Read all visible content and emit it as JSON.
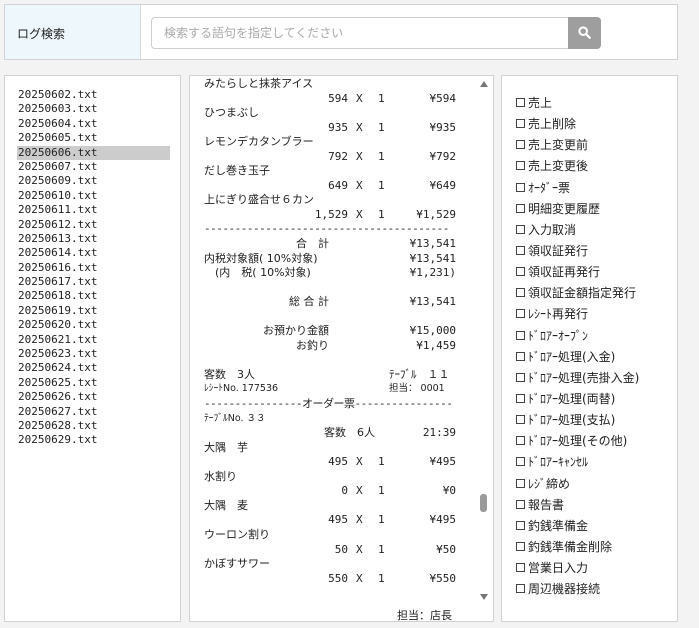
{
  "header": {
    "title": "ログ検索",
    "search_placeholder": "検索する語句を指定してください",
    "search_icon": "search-icon"
  },
  "files": [
    "20250602.txt",
    "20250603.txt",
    "20250604.txt",
    "20250605.txt",
    "20250606.txt",
    "20250607.txt",
    "20250609.txt",
    "20250610.txt",
    "20250611.txt",
    "20250612.txt",
    "20250613.txt",
    "20250614.txt",
    "20250616.txt",
    "20250617.txt",
    "20250618.txt",
    "20250619.txt",
    "20250620.txt",
    "20250621.txt",
    "20250623.txt",
    "20250624.txt",
    "20250625.txt",
    "20250626.txt",
    "20250627.txt",
    "20250628.txt",
    "20250629.txt"
  ],
  "selected_file_index": 4,
  "receipt": {
    "lines": [
      {
        "k": "name",
        "t": "みたらしと抹茶アイス"
      },
      {
        "k": "item",
        "a": "594",
        "x": "X",
        "q": "1",
        "p": "¥594"
      },
      {
        "k": "name",
        "t": "ひつまぶし"
      },
      {
        "k": "item",
        "a": "935",
        "x": "X",
        "q": "1",
        "p": "¥935"
      },
      {
        "k": "name",
        "t": "レモンデカタンブラー"
      },
      {
        "k": "item",
        "a": "792",
        "x": "X",
        "q": "1",
        "p": "¥792"
      },
      {
        "k": "name",
        "t": "だし巻き玉子"
      },
      {
        "k": "item",
        "a": "649",
        "x": "X",
        "q": "1",
        "p": "¥649"
      },
      {
        "k": "name",
        "t": "上にぎり盛合せ６カン"
      },
      {
        "k": "item",
        "a": "1,529",
        "x": "X",
        "q": "1",
        "p": "¥1,529"
      },
      {
        "k": "dash",
        "t": "----------------------------------------"
      },
      {
        "k": "total",
        "l": "合　計",
        "v": "¥13,541"
      },
      {
        "k": "lv",
        "l": "内税対象額( 10%対象)",
        "v": "¥13,541"
      },
      {
        "k": "lv",
        "l": "　(内　税( 10%対象)",
        "v": "¥1,231)"
      },
      {
        "k": "blank"
      },
      {
        "k": "total",
        "l": "総 合 計",
        "v": "¥13,541"
      },
      {
        "k": "blank"
      },
      {
        "k": "total",
        "l": "お預かり金額",
        "v": "¥15,000"
      },
      {
        "k": "total",
        "l": "お釣り",
        "v": "¥1,459"
      },
      {
        "k": "blank"
      },
      {
        "k": "info",
        "l": "客数　3人",
        "r": "ﾃｰﾌﾞﾙ　１１"
      },
      {
        "k": "info",
        "l": "ﾚｼｰﾄNo. 177536",
        "r": "担当： 0001",
        "small": true
      },
      {
        "k": "dash",
        "t": "----------------オーダー票----------------"
      },
      {
        "k": "name",
        "t": "ﾃｰﾌﾞﾙNo. ３３",
        "small": true
      },
      {
        "k": "info2",
        "l": "客数　6人",
        "r": "21:39"
      },
      {
        "k": "name",
        "t": "大隅　芋"
      },
      {
        "k": "item",
        "a": "495",
        "x": "X",
        "q": "1",
        "p": "¥495"
      },
      {
        "k": "name",
        "t": "水割り"
      },
      {
        "k": "item",
        "a": "0",
        "x": "X",
        "q": "1",
        "p": "¥0"
      },
      {
        "k": "name",
        "t": "大隅　麦"
      },
      {
        "k": "item",
        "a": "495",
        "x": "X",
        "q": "1",
        "p": "¥495"
      },
      {
        "k": "name",
        "t": "ウーロン割り"
      },
      {
        "k": "item",
        "a": "50",
        "x": "X",
        "q": "1",
        "p": "¥50"
      },
      {
        "k": "name",
        "t": "かぼすサワー"
      },
      {
        "k": "item",
        "a": "550",
        "x": "X",
        "q": "1",
        "p": "¥550"
      },
      {
        "k": "blank"
      },
      {
        "k": "cut",
        "t": "担当：店長"
      }
    ]
  },
  "operations": [
    "売上",
    "売上削除",
    "売上変更前",
    "売上変更後",
    "ｵｰﾀﾞｰ票",
    "明細変更履歴",
    "入力取消",
    "領収証発行",
    "領収証再発行",
    "領収証金額指定発行",
    "ﾚｼｰﾄ再発行",
    "ﾄﾞﾛｱｰｵｰﾌﾟﾝ",
    "ﾄﾞﾛｱｰ処理(入金)",
    "ﾄﾞﾛｱｰ処理(売掛入金)",
    "ﾄﾞﾛｱｰ処理(両替)",
    "ﾄﾞﾛｱｰ処理(支払)",
    "ﾄﾞﾛｱｰ処理(その他)",
    "ﾄﾞﾛｱｰｷｬﾝｾﾙ",
    "ﾚｼﾞ締め",
    "報告書",
    "釣銭準備金",
    "釣銭準備金削除",
    "営業日入力",
    "周辺機器接続"
  ]
}
